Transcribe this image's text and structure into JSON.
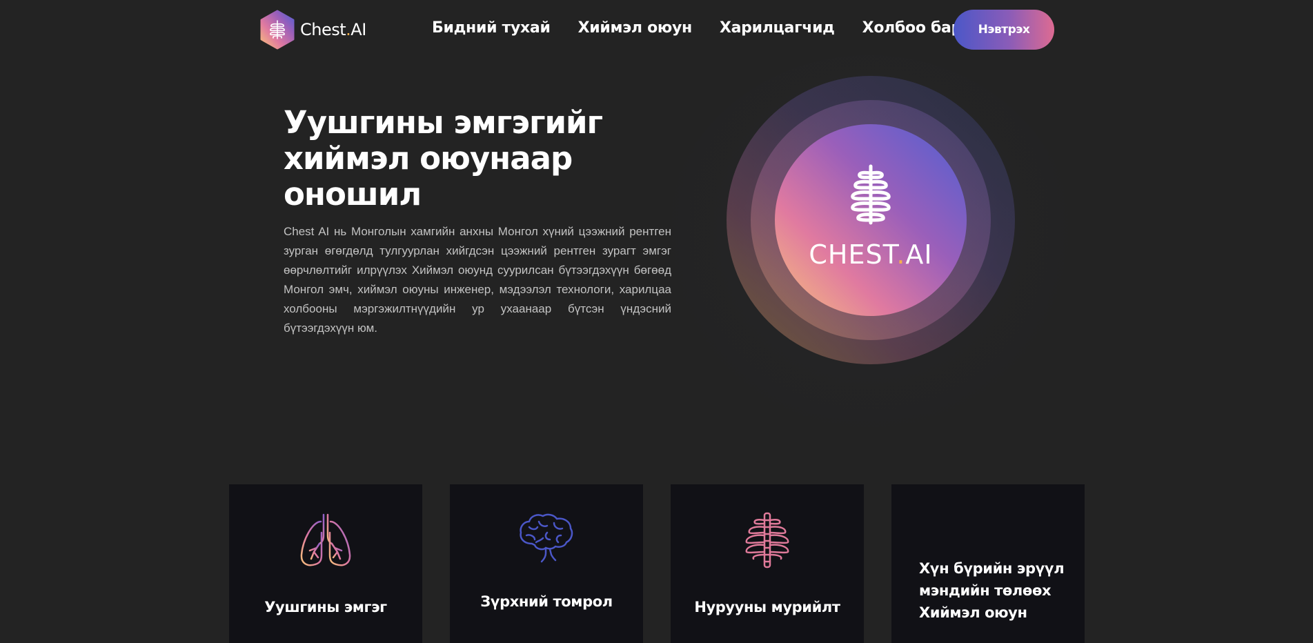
{
  "brand": {
    "name": "Chest",
    "dot": ".",
    "suffix": "AI"
  },
  "nav": {
    "items": [
      "Бидний тухай",
      "Хиймэл оюун",
      "Харилцагчид",
      "Холбоо барих"
    ],
    "login_label": "Нэвтрэх"
  },
  "hero": {
    "title": "Уушгины эмгэгийг хиймэл оюунаар оношил",
    "description": "Chest AI нь Монголын хамгийн анхны Монгол хүний цээжний рентген зурган өгөгдөлд тулгуурлан хийгдсэн цээжний рентген зурагт эмгэг өөрчлөлтийг илрүүлэх Хиймэл оюунд суурилсан бүтээгдэхүүн бөгөөд Монгол эмч, хиймэл оюуны инженер, мэдээлэл технологи, харилцаа холбооны мэргэжилтнүүдийн ур ухаанаар бүтсэн үндэсний бүтээгдэхүүн юм.",
    "emblem": {
      "name": "CHEST",
      "dot": ".",
      "suffix": "AI"
    }
  },
  "cards": [
    {
      "label": "Уушгины эмгэг",
      "icon": "lungs-icon"
    },
    {
      "label": "Зүрхний томрол",
      "icon": "brain-icon"
    },
    {
      "label": "Нурууны мурийлт",
      "icon": "ribcage-icon"
    },
    {
      "label": "Хүн бүрийн эрүүл мэндийн төлөөх Хиймэл оюун",
      "icon": ""
    }
  ],
  "colors": {
    "background": "#232323",
    "card": "#111116",
    "accent_dot": "#f5b14c",
    "gradient_start": "#4b57c8",
    "gradient_end": "#dd6b92"
  }
}
